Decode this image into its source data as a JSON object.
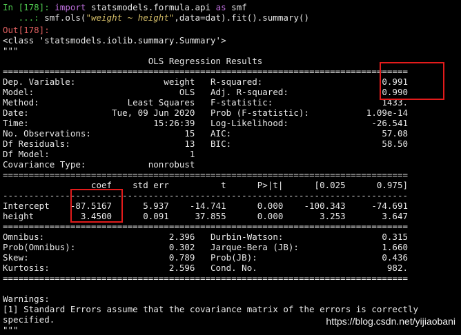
{
  "input": {
    "prompt_in": "In [178]: ",
    "line1_kw1": "import",
    "line1_mid": " statsmodels.formula.api ",
    "line1_kw2": "as",
    "line1_end": " smf",
    "cont_prompt": "   ...: ",
    "line2_a": "smf.ols(",
    "line2_str": "\"weight ~ height\"",
    "line2_b": ",data=dat).fit().summary()"
  },
  "output": {
    "prompt_out": "Out[178]:",
    "class_line": "<class 'statsmodels.iolib.summary.Summary'>",
    "triple_quote": "\"\"\"",
    "title": "                            OLS Regression Results                            "
  },
  "lines": {
    "eq": "==============================================================================",
    "dash": "------------------------------------------------------------------------------",
    "t1": "Dep. Variable:                 weight   R-squared:                       0.991",
    "t2": "Model:                            OLS   Adj. R-squared:                  0.990",
    "t3": "Method:                 Least Squares   F-statistic:                     1433.",
    "t4": "Date:                Tue, 09 Jun 2020   Prob (F-statistic):           1.09e-14",
    "t5": "Time:                        15:26:39   Log-Likelihood:                -26.541",
    "t6": "No. Observations:                  15   AIC:                             57.08",
    "t7": "Df Residuals:                      13   BIC:                             58.50",
    "t8": "Df Model:                           1                                         ",
    "t9": "Covariance Type:            nonrobust                                         ",
    "ch": "                 coef    std err          t      P>|t|      [0.025      0.975]",
    "r1": "Intercept    -87.5167      5.937    -14.741      0.000    -100.343     -74.691",
    "r2": "height         3.4500      0.091     37.855      0.000       3.253       3.647",
    "s1": "Omnibus:                        2.396   Durbin-Watson:                   0.315",
    "s2": "Prob(Omnibus):                  0.302   Jarque-Bera (JB):                1.660",
    "s3": "Skew:                           0.789   Prob(JB):                        0.436",
    "s4": "Kurtosis:                       2.596   Cond. No.                         982."
  },
  "warnings": {
    "title": "Warnings:",
    "w1": "[1] Standard Errors assume that the covariance matrix of the errors is correctly",
    "w2": "specified."
  },
  "watermark": "https://blog.csdn.net/yijiaobani",
  "colors": {
    "background": "#000000",
    "prompt_in": "#4ec94e",
    "prompt_out": "#e06060",
    "keyword": "#c070e0",
    "string": "#d9c26b",
    "highlight": "#e31b1b"
  }
}
